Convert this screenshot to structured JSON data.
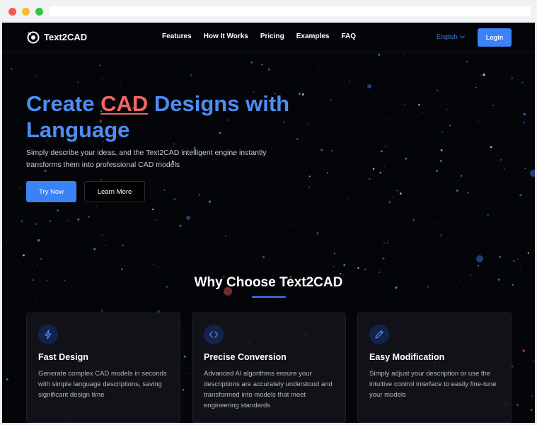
{
  "brand": {
    "name": "Text2CAD",
    "logo_icon": "target-cursor-icon"
  },
  "nav": {
    "links": [
      "Features",
      "How It Works",
      "Pricing",
      "Examples",
      "FAQ"
    ],
    "language": "English",
    "login_label": "Login"
  },
  "hero": {
    "title_part1": "Create ",
    "title_highlight": "CAD",
    "title_part2": " Designs with Language",
    "subtitle": "Simply describe your ideas, and the Text2CAD intelligent engine instantly transforms them into professional CAD models",
    "primary_cta": "Try Now",
    "secondary_cta": "Learn More"
  },
  "features": {
    "title": "Why Choose Text2CAD",
    "cards": [
      {
        "icon": "lightning-icon",
        "title": "Fast Design",
        "description": "Generate complex CAD models in seconds with simple language descriptions, saving significant design time"
      },
      {
        "icon": "code-brackets-icon",
        "title": "Precise Conversion",
        "description": "Advanced AI algorithms ensure your descriptions are accurately understood and transformed into models that meet engineering standards"
      },
      {
        "icon": "pencil-icon",
        "title": "Easy Modification",
        "description": "Simply adjust your description or use the intuitive control interface to easily fine-tune your models"
      }
    ]
  },
  "colors": {
    "accent": "#3b82f6",
    "highlight": "#f06565",
    "background": "#040508"
  }
}
